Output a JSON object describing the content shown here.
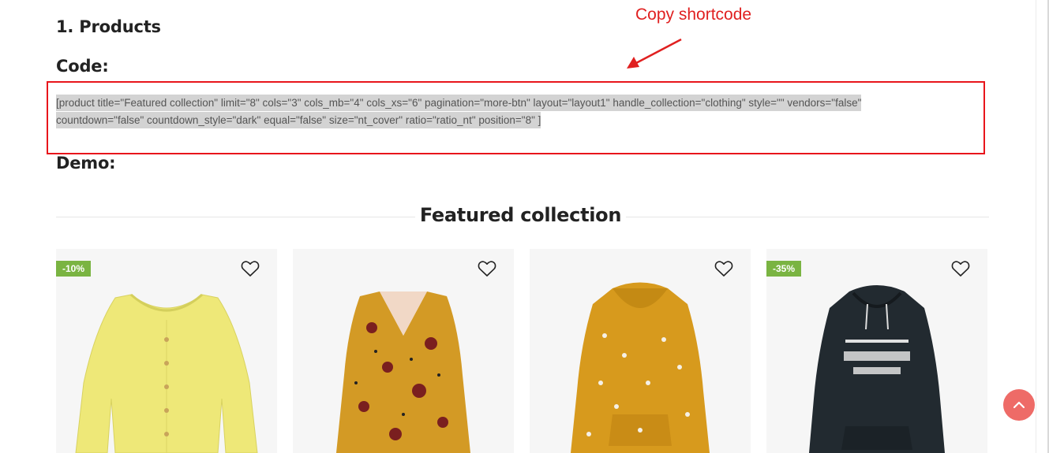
{
  "headings": {
    "products": "1. Products",
    "code": "Code:",
    "demo": "Demo:"
  },
  "code": {
    "shortcode_line1": "[product title=\"Featured collection\" limit=\"8\" cols=\"3\" cols_mb=\"4\" cols_xs=\"6\" pagination=\"more-btn\" layout=\"layout1\" handle_collection=\"clothing\" style=\"\" vendors=\"false\"",
    "shortcode_line2": "countdown=\"false\" countdown_style=\"dark\" equal=\"false\" size=\"nt_cover\" ratio=\"ratio_nt\" position=\"8\" ]"
  },
  "annotation": {
    "text": "Copy shortcode",
    "color": "#e02020"
  },
  "section": {
    "title": "Featured collection"
  },
  "products": [
    {
      "badge": "-10%",
      "image": "yellow-cardigan",
      "wishlist_icon": "heart-icon"
    },
    {
      "badge": "",
      "image": "mustard-floral-blouse",
      "wishlist_icon": "heart-icon"
    },
    {
      "badge": "",
      "image": "mustard-print-hoodie",
      "wishlist_icon": "heart-icon"
    },
    {
      "badge": "-35%",
      "image": "black-hoodie",
      "wishlist_icon": "heart-icon"
    }
  ],
  "colors": {
    "badge": "#7ab442",
    "highlight_box": "#e8151b",
    "back_to_top": "#ee6b67"
  },
  "back_to_top_icon": "chevron-up-icon"
}
